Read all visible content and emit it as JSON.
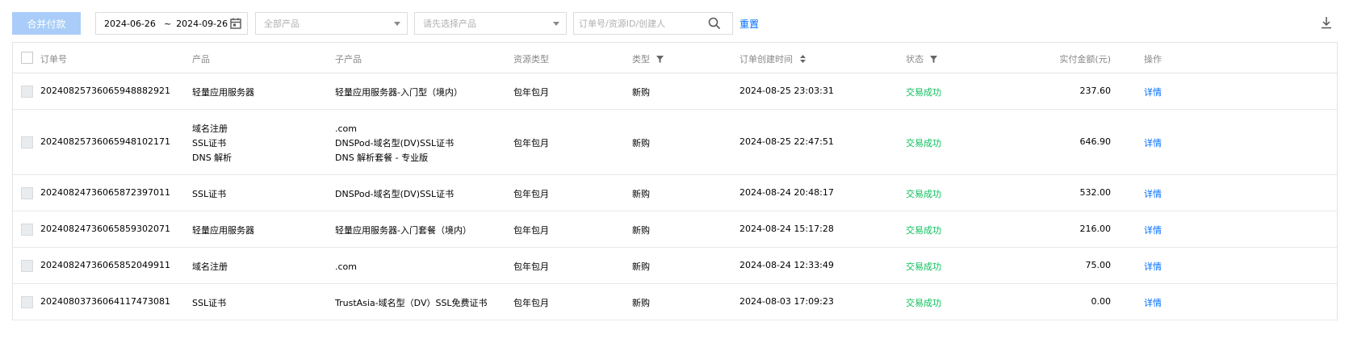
{
  "toolbar": {
    "merge_pay_label": "合并付款",
    "date_start": "2024-06-26",
    "date_sep": "~",
    "date_end": "2024-09-26",
    "product_select": "全部产品",
    "subproduct_select": "请先选择产品",
    "search_placeholder": "订单号/资源ID/创建人",
    "reset_label": "重置"
  },
  "table": {
    "headers": {
      "order": "订单号",
      "product": "产品",
      "subproduct": "子产品",
      "resource_type": "资源类型",
      "type": "类型",
      "created": "订单创建时间",
      "status": "状态",
      "amount": "实付金额(元)",
      "operation": "操作"
    },
    "rows": [
      {
        "order": "20240825736065948882921",
        "products": [
          "轻量应用服务器"
        ],
        "subproducts": [
          "轻量应用服务器-入门型（境内）"
        ],
        "resource_type": "包年包月",
        "type": "新购",
        "created": "2024-08-25 23:03:31",
        "status": "交易成功",
        "amount": "237.60",
        "op": "详情"
      },
      {
        "order": "20240825736065948102171",
        "products": [
          "域名注册",
          "SSL证书",
          "DNS 解析"
        ],
        "subproducts": [
          ".com",
          "DNSPod-域名型(DV)SSL证书",
          "DNS 解析套餐 - 专业版"
        ],
        "resource_type": "包年包月",
        "type": "新购",
        "created": "2024-08-25 22:47:51",
        "status": "交易成功",
        "amount": "646.90",
        "op": "详情"
      },
      {
        "order": "20240824736065872397011",
        "products": [
          "SSL证书"
        ],
        "subproducts": [
          "DNSPod-域名型(DV)SSL证书"
        ],
        "resource_type": "包年包月",
        "type": "新购",
        "created": "2024-08-24 20:48:17",
        "status": "交易成功",
        "amount": "532.00",
        "op": "详情"
      },
      {
        "order": "20240824736065859302071",
        "products": [
          "轻量应用服务器"
        ],
        "subproducts": [
          "轻量应用服务器-入门套餐（境内）"
        ],
        "resource_type": "包年包月",
        "type": "新购",
        "created": "2024-08-24 15:17:28",
        "status": "交易成功",
        "amount": "216.00",
        "op": "详情"
      },
      {
        "order": "20240824736065852049911",
        "products": [
          "域名注册"
        ],
        "subproducts": [
          ".com"
        ],
        "resource_type": "包年包月",
        "type": "新购",
        "created": "2024-08-24 12:33:49",
        "status": "交易成功",
        "amount": "75.00",
        "op": "详情"
      },
      {
        "order": "20240803736064117473081",
        "products": [
          "SSL证书"
        ],
        "subproducts": [
          "TrustAsia-域名型（DV）SSL免费证书"
        ],
        "resource_type": "包年包月",
        "type": "新购",
        "created": "2024-08-03 17:09:23",
        "status": "交易成功",
        "amount": "0.00",
        "op": "详情"
      }
    ]
  },
  "colors": {
    "accent": "#006eff",
    "success": "#0abf5b",
    "disabled_button": "#a9cdf8",
    "border": "#e3e3e3"
  },
  "icons": [
    "calendar-icon",
    "chevron-down-icon",
    "search-icon",
    "download-icon",
    "filter-icon",
    "sort-icon"
  ]
}
